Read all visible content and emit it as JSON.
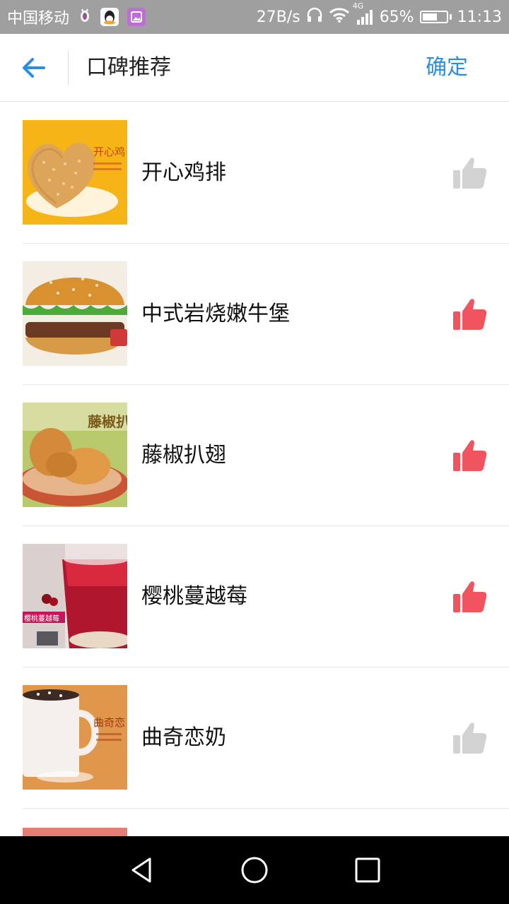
{
  "status_bar": {
    "carrier": "中国移动",
    "net_speed": "27B/s",
    "network_type": "4G",
    "battery": "65%",
    "battery_level": 0.65,
    "time": "11:13"
  },
  "header": {
    "title": "口碑推荐",
    "confirm_label": "确定",
    "accent_color": "#2a8ee0"
  },
  "items": [
    {
      "name": "开心鸡排",
      "liked": false,
      "thumb_text": "开心鸡"
    },
    {
      "name": "中式岩烧嫩牛堡",
      "liked": true,
      "thumb_text": ""
    },
    {
      "name": "藤椒扒翅",
      "liked": true,
      "thumb_text": "藤椒扒"
    },
    {
      "name": "樱桃蔓越莓",
      "liked": true,
      "thumb_text": "樱桃蔓越莓"
    },
    {
      "name": "曲奇恋奶",
      "liked": false,
      "thumb_text": "曲奇恋"
    }
  ],
  "colors": {
    "liked": "#f0545e",
    "unliked": "#d2d2d2"
  },
  "icons": {
    "back": "arrow-left-icon",
    "like": "thumbs-up-icon",
    "nav_back": "triangle-back-icon",
    "nav_home": "circle-home-icon",
    "nav_recent": "square-recent-icon"
  }
}
